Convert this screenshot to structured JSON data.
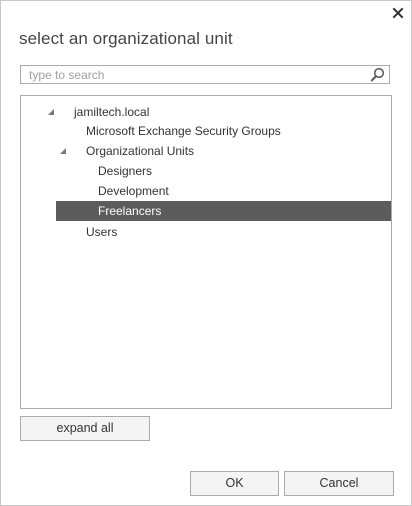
{
  "dialog": {
    "title": "select an organizational unit",
    "close_icon": "close-icon"
  },
  "search": {
    "placeholder": "type to search",
    "value": "",
    "icon": "search-icon"
  },
  "tree": {
    "nodes": [
      {
        "label": "jamiltech.local",
        "level": 0,
        "expanded": true,
        "has_children": true,
        "selected": false
      },
      {
        "label": "Microsoft Exchange Security Groups",
        "level": 1,
        "expanded": false,
        "has_children": false,
        "selected": false
      },
      {
        "label": "Organizational Units",
        "level": 1,
        "expanded": true,
        "has_children": true,
        "selected": false
      },
      {
        "label": "Designers",
        "level": 2,
        "expanded": false,
        "has_children": false,
        "selected": false
      },
      {
        "label": "Development",
        "level": 2,
        "expanded": false,
        "has_children": false,
        "selected": false
      },
      {
        "label": "Freelancers",
        "level": 2,
        "expanded": false,
        "has_children": false,
        "selected": true
      },
      {
        "label": "Users",
        "level": 1,
        "expanded": false,
        "has_children": false,
        "selected": false
      }
    ],
    "selected_bg": "#5c5c5c"
  },
  "buttons": {
    "expand_all": "expand all",
    "ok": "OK",
    "cancel": "Cancel"
  }
}
